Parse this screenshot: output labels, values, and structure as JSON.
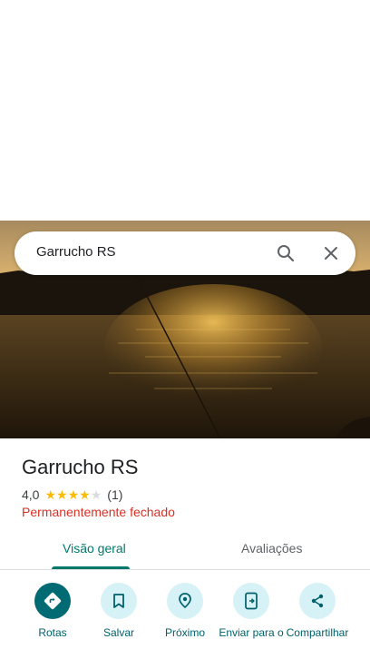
{
  "search": {
    "query": "Garrucho RS"
  },
  "place": {
    "title": "Garrucho RS",
    "rating_value": "4,0",
    "rating_stars": 4,
    "review_count": "(1)",
    "status": "Permanentemente fechado"
  },
  "tabs": [
    {
      "label": "Visão geral",
      "active": true
    },
    {
      "label": "Avaliações",
      "active": false
    }
  ],
  "actions": [
    {
      "label": "Rotas",
      "icon": "directions-icon"
    },
    {
      "label": "Salvar",
      "icon": "bookmark-icon"
    },
    {
      "label": "Próximo",
      "icon": "nearby-icon"
    },
    {
      "label": "Enviar para o",
      "icon": "send-to-phone-icon"
    },
    {
      "label": "Compartilhar",
      "icon": "share-icon"
    }
  ],
  "colors": {
    "accent": "#00796b",
    "primary_button": "#006b73",
    "secondary_button_bg": "#d7f2f6",
    "status_red": "#d93025",
    "star_gold": "#fbbc04"
  }
}
